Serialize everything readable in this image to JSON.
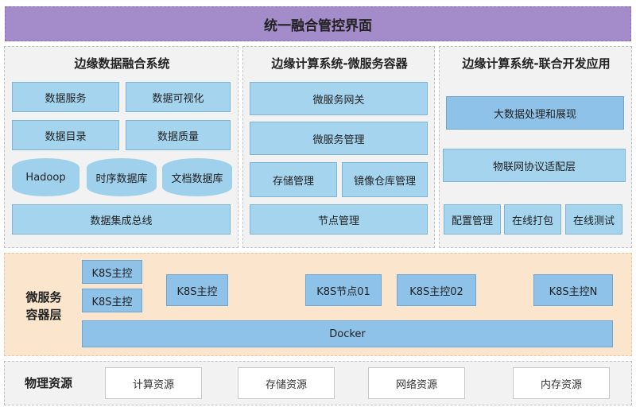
{
  "title": "统一融合管控界面",
  "panels": {
    "left": {
      "title": "边缘数据融合系统",
      "boxes": [
        "数据服务",
        "数据可视化",
        "数据目录",
        "数据质量"
      ],
      "cylinders": [
        "Hadoop",
        "时序数据库",
        "文档数据库"
      ],
      "bus": "数据集成总线"
    },
    "middle": {
      "title": "边缘计算系统-微服务容器",
      "gateway": "微服务网关",
      "management": "微服务管理",
      "storage": "存储管理",
      "registry": "镜像仓库管理",
      "node": "节点管理"
    },
    "right": {
      "title": "边缘计算系统-联合开发应用",
      "bigdata": "大数据处理和展现",
      "iot": "物联网协议适配层",
      "small": [
        "配置管理",
        "在线打包",
        "在线测试"
      ]
    }
  },
  "microservice_layer": {
    "label_line1": "微服务",
    "label_line2": "容器层",
    "k8s_master_a": "K8S主控",
    "k8s_master_b": "K8S主控",
    "k8s_master_c": "K8S主控",
    "k8s_node01": "K8S节点01",
    "k8s_master02": "K8S主控02",
    "k8s_masterN": "K8S主控N",
    "docker": "Docker"
  },
  "physical": {
    "label": "物理资源",
    "resources": [
      "计算资源",
      "存储资源",
      "网络资源",
      "内存资源"
    ]
  },
  "colors": {
    "title_bar": "#a48bc9",
    "box_light": "#a4d4ee",
    "box_dark": "#8ec2e8",
    "microservice_bg": "#fbe5cc",
    "panel_bg": "#f2f2f2"
  }
}
